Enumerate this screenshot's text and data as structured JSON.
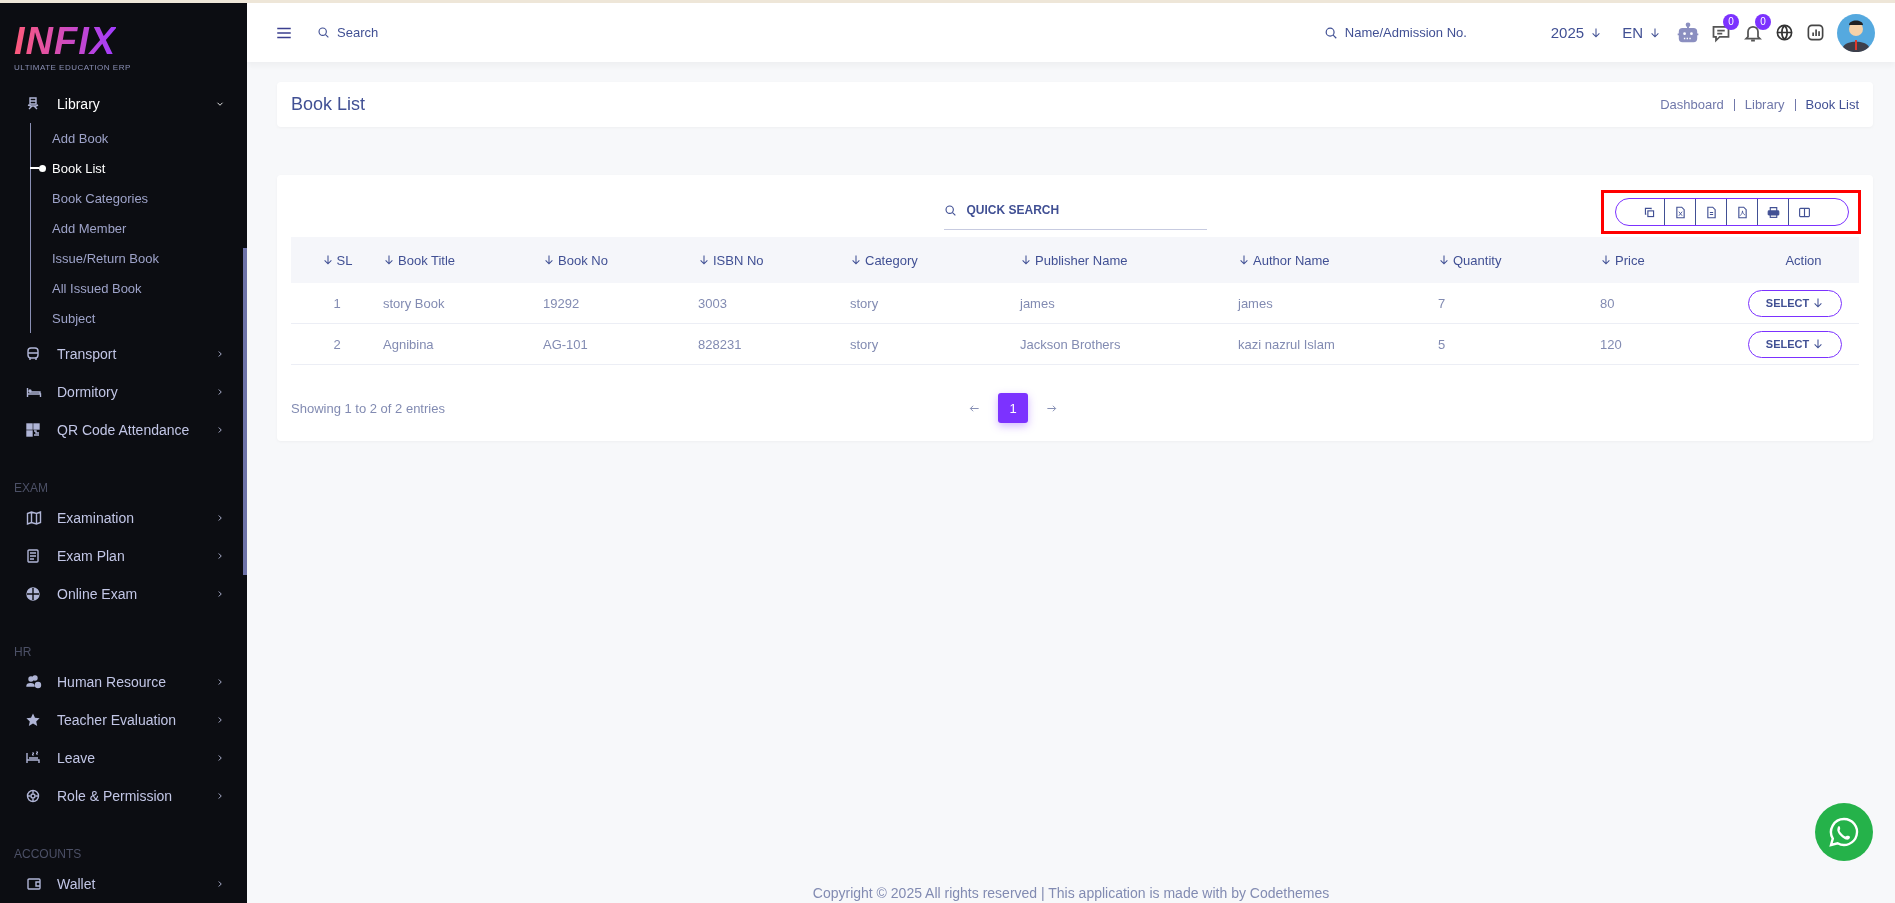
{
  "sidebar": {
    "logo": "INFIX",
    "tagline": "ULTIMATE EDUCATION ERP",
    "sections": [
      {
        "items": [
          {
            "label": "Library",
            "expanded": true,
            "children": [
              {
                "label": "Add Book",
                "selected": false
              },
              {
                "label": "Book List",
                "selected": true
              },
              {
                "label": "Book Categories",
                "selected": false
              },
              {
                "label": "Add Member",
                "selected": false
              },
              {
                "label": "Issue/Return Book",
                "selected": false
              },
              {
                "label": "All Issued Book",
                "selected": false
              },
              {
                "label": "Subject",
                "selected": false
              }
            ]
          },
          {
            "label": "Transport",
            "expanded": false
          },
          {
            "label": "Dormitory",
            "expanded": false
          },
          {
            "label": "QR Code Attendance",
            "expanded": false
          }
        ]
      },
      {
        "heading": "EXAM",
        "items": [
          {
            "label": "Examination",
            "expanded": false
          },
          {
            "label": "Exam Plan",
            "expanded": false
          },
          {
            "label": "Online Exam",
            "expanded": false
          }
        ]
      },
      {
        "heading": "HR",
        "items": [
          {
            "label": "Human Resource",
            "expanded": false
          },
          {
            "label": "Teacher Evaluation",
            "expanded": false
          },
          {
            "label": "Leave",
            "expanded": false
          },
          {
            "label": "Role & Permission",
            "expanded": false
          }
        ]
      },
      {
        "heading": "ACCOUNTS",
        "items": [
          {
            "label": "Wallet",
            "expanded": false
          }
        ]
      }
    ]
  },
  "topbar": {
    "search": {
      "placeholder": "Search"
    },
    "student_search": {
      "placeholder": "Name/Admission No."
    },
    "year": "2025",
    "language": "EN",
    "messages_badge": "0",
    "notifications_badge": "0"
  },
  "page_header": {
    "title": "Book List",
    "breadcrumbs": [
      "Dashboard",
      "Library",
      "Book List"
    ]
  },
  "book_table": {
    "quick_search": {
      "placeholder": "QUICK SEARCH"
    },
    "export_toolbar": {
      "highlighted": true
    },
    "columns": [
      {
        "label": "SL",
        "sortable": true
      },
      {
        "label": "Book Title",
        "sortable": true
      },
      {
        "label": "Book No",
        "sortable": true
      },
      {
        "label": "ISBN No",
        "sortable": true
      },
      {
        "label": "Category",
        "sortable": true
      },
      {
        "label": "Publisher Name",
        "sortable": true
      },
      {
        "label": "Author Name",
        "sortable": true
      },
      {
        "label": "Quantity",
        "sortable": true
      },
      {
        "label": "Price",
        "sortable": true
      },
      {
        "label": "Action",
        "sortable": false
      }
    ],
    "rows": [
      {
        "cells": [
          "1",
          "story Book",
          "19292",
          "3003",
          "story",
          "james",
          "james",
          "7",
          "80"
        ],
        "action": "SELECT"
      },
      {
        "cells": [
          "2",
          "Agnibina",
          "AG-101",
          "828231",
          "story",
          "Jackson Brothers",
          "kazi nazrul Islam",
          "5",
          "120"
        ],
        "action": "SELECT"
      }
    ],
    "info": "Showing 1 to 2 of 2 entries",
    "pages": [
      {
        "label": "1",
        "selected": true
      }
    ]
  },
  "footer": {
    "copyright": "Copyright © 2025 All rights reserved | This application is made with by Codethemes"
  }
}
